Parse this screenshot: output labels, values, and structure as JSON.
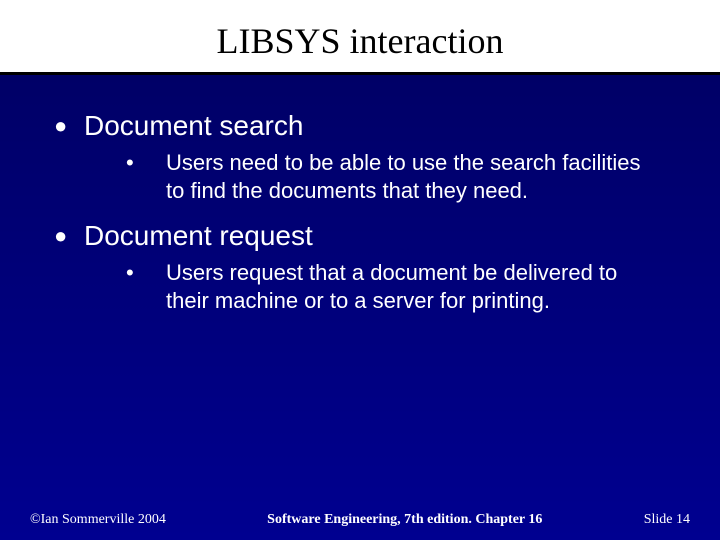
{
  "title": "LIBSYS interaction",
  "items": [
    {
      "heading": "Document search",
      "sub": "Users need to be able to use the search facilities to find the documents that they need."
    },
    {
      "heading": "Document request",
      "sub": "Users request that a document be delivered to their machine or to a server for printing."
    }
  ],
  "footer": {
    "left": "©Ian Sommerville 2004",
    "center": "Software Engineering, 7th edition. Chapter 16",
    "right_prefix": "Slide ",
    "right_number": "14"
  },
  "bullets": {
    "lvl1": "●",
    "lvl2": "•"
  }
}
